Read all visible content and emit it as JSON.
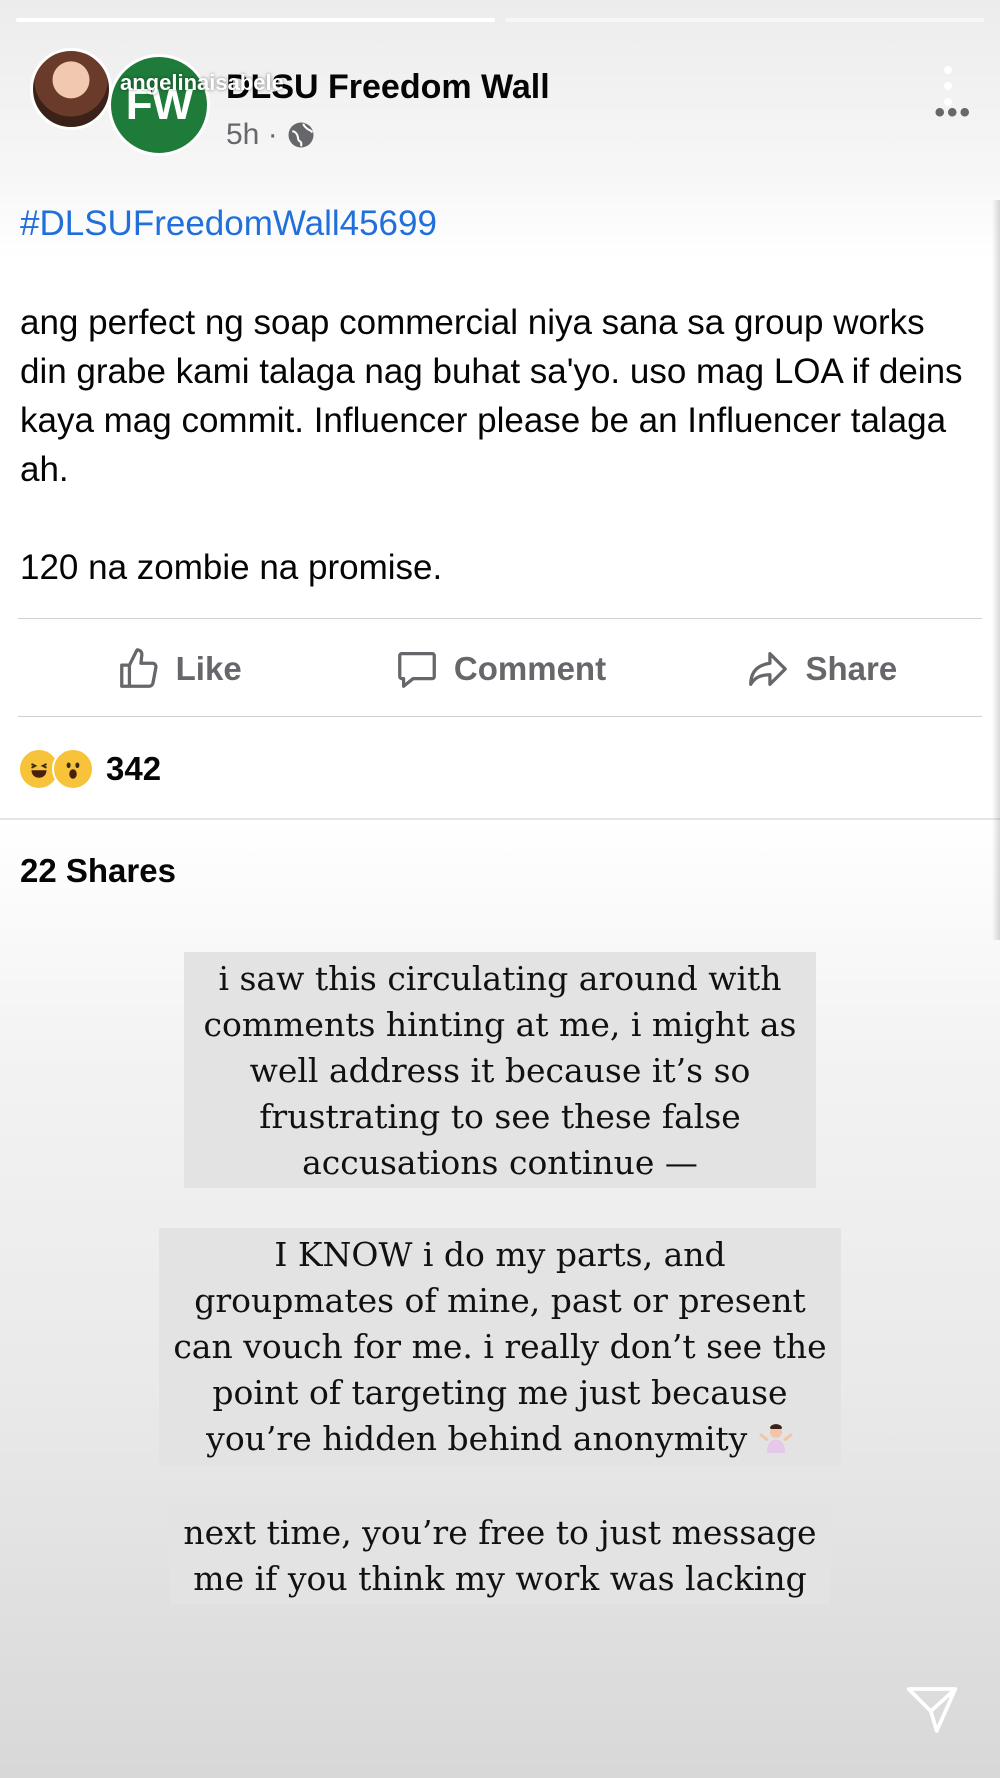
{
  "story": {
    "progress": [
      1.0,
      0.0
    ],
    "username": "angelinaisabele"
  },
  "post": {
    "page_name": "DLSU Freedom Wall",
    "page_avatar_text": "FW",
    "time": "5h ·",
    "hashtag": "#DLSUFreedomWall45699",
    "paragraphs": [
      "ang perfect ng soap commercial niya sana sa group works din grabe kami talaga nag buhat sa'yo. uso mag LOA if deins kaya mag commit. Influencer please be an Influencer talaga ah.",
      "120 na zombie na promise."
    ],
    "actions": {
      "like": "Like",
      "comment": "Comment",
      "share": "Share"
    },
    "reaction_count": "342",
    "shares": "22 Shares"
  },
  "captions": {
    "first": [
      "i saw this circulating around with",
      "comments hinting at me, i might as",
      "well address it because it’s so",
      "frustrating to see these false",
      "accusations continue —"
    ],
    "second": [
      "I KNOW i do my parts, and",
      "groupmates of mine, past or present",
      "can vouch for me. i really don’t see the",
      "point of targeting me just because",
      "you’re hidden behind anonymity"
    ],
    "third": [
      "next time, you’re free to just message",
      "me if you think my work was lacking"
    ]
  },
  "icons": {
    "globe": "globe-icon",
    "more": "more-options-icon",
    "like": "thumbs-up-icon",
    "comment": "speech-bubble-icon",
    "share": "share-arrow-icon",
    "send": "send-icon",
    "shrug": "person-shrugging-emoji"
  },
  "colors": {
    "link": "#216fdb",
    "page_avatar": "#1e7b3a",
    "secondary_text": "#65676b",
    "caption_bg": "#e3e3e3"
  }
}
